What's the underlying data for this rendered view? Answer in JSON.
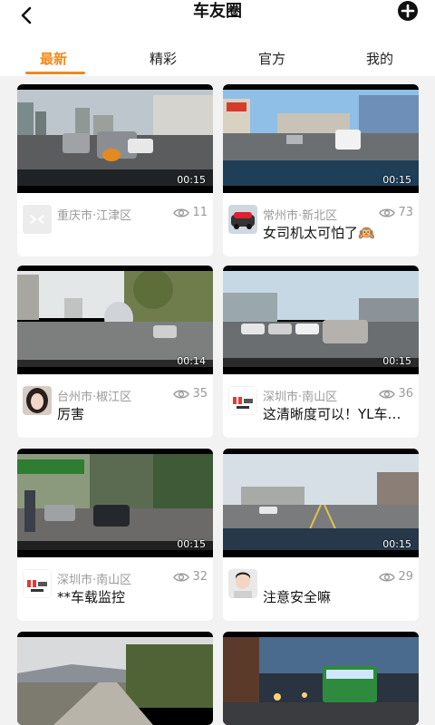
{
  "header": {
    "title": "车友圈",
    "back_icon": "chevron-left-icon",
    "add_icon": "plus-circle-icon"
  },
  "tabs": [
    {
      "label": "最新",
      "active": true
    },
    {
      "label": "精彩",
      "active": false
    },
    {
      "label": "官方",
      "active": false
    },
    {
      "label": "我的",
      "active": false
    }
  ],
  "colors": {
    "accent": "#f08a1c",
    "muted": "#9a9a9a"
  },
  "posts": [
    {
      "duration": "00:15",
      "location": "重庆市·江津区",
      "views": "11",
      "text": ""
    },
    {
      "duration": "00:15",
      "location": "常州市·新北区",
      "views": "73",
      "text": "女司机太可怕了🙉"
    },
    {
      "duration": "00:14",
      "location": "台州市·椒江区",
      "views": "35",
      "text": "厉害"
    },
    {
      "duration": "00:15",
      "location": "深圳市·南山区",
      "views": "36",
      "text": "这清晰度可以！YL车…"
    },
    {
      "duration": "00:15",
      "location": "深圳市·南山区",
      "views": "32",
      "text": "**车载监控"
    },
    {
      "duration": "00:15",
      "location": "",
      "views": "29",
      "text": "注意安全嘛"
    },
    {
      "duration": "",
      "location": "",
      "views": "",
      "text": ""
    },
    {
      "duration": "",
      "location": "",
      "views": "",
      "text": ""
    }
  ]
}
